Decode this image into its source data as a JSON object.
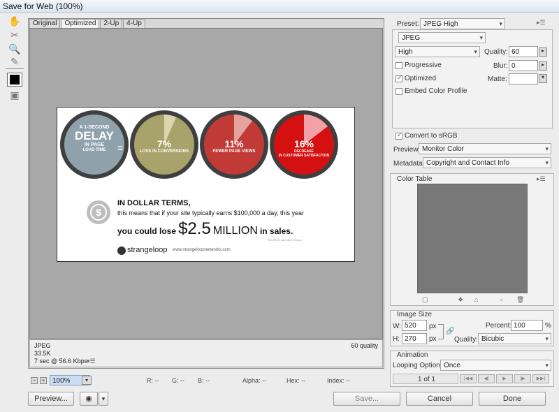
{
  "window": {
    "title": "Save for Web (100%)"
  },
  "tabs": [
    "Original",
    "Optimized",
    "2-Up",
    "4-Up"
  ],
  "infobar": {
    "format": "JPEG",
    "size": "33.5K",
    "time": "7 sec @ 56.6 Kbps",
    "quality": "60 quality"
  },
  "zoombar": {
    "zoom": "100%",
    "r": "R: --",
    "g": "G: --",
    "b": "B: --",
    "alpha": "Alpha: --",
    "hex": "Hex: --",
    "index": "Index: --"
  },
  "bottom_buttons": {
    "preview": "Preview...",
    "save": "Save...",
    "cancel": "Cancel",
    "done": "Done"
  },
  "settings": {
    "preset_label": "Preset:",
    "preset_value": "JPEG High",
    "format": "JPEG",
    "quality_preset": "High",
    "quality_label": "Quality:",
    "quality_value": "60",
    "progressive_label": "Progressive",
    "blur_label": "Blur:",
    "blur_value": "0",
    "optimized_label": "Optimized",
    "matte_label": "Matte:",
    "embed_label": "Embed Color Profile",
    "convert_label": "Convert to sRGB",
    "preview_label": "Preview:",
    "preview_value": "Monitor Color",
    "metadata_label": "Metadata:",
    "metadata_value": "Copyright and Contact Info"
  },
  "color_table": {
    "title": "Color Table"
  },
  "image_size": {
    "title": "Image Size",
    "w_label": "W:",
    "w_value": "520",
    "h_label": "H:",
    "h_value": "270",
    "unit": "px",
    "percent_label": "Percent:",
    "percent_value": "100",
    "percent_unit": "%",
    "quality_label": "Quality:",
    "quality_value": "Bicubic"
  },
  "animation": {
    "title": "Animation",
    "looping_label": "Looping Options:",
    "looping_value": "Once",
    "frame": "1 of 1"
  },
  "artwork": {
    "stat1_prefix": "A 1-SECOND",
    "stat1_big": "DELAY",
    "stat1_suffix1": "IN PAGE",
    "stat1_suffix2": "LOAD TIME",
    "equals": "=",
    "stat2_pct": "7%",
    "stat2_label": "LOSS IN CONVERSIONS",
    "stat3_pct": "11%",
    "stat3_label": "FEWER PAGE VIEWS",
    "stat4_pct": "16%",
    "stat4_label1": "DECREASE",
    "stat4_label2": "IN CUSTOMER SATISFACTION",
    "line1": "IN DOLLAR TERMS,",
    "line2": "this means that if your site typically earns $100,000 a day, this year",
    "line3a": "you could lose",
    "line3b": "$2.5",
    "line3c": "MILLION",
    "line3d": "in sales.",
    "source": "SOURCE: Aberdeen Group",
    "brand": "strangeloop",
    "url": "www.strangeloopnetworks.com",
    "colors": {
      "circle1": "#8fa2ac",
      "circle2": "#a8a36a",
      "circle3": "#c23a36",
      "circle4": "#d41010"
    }
  }
}
